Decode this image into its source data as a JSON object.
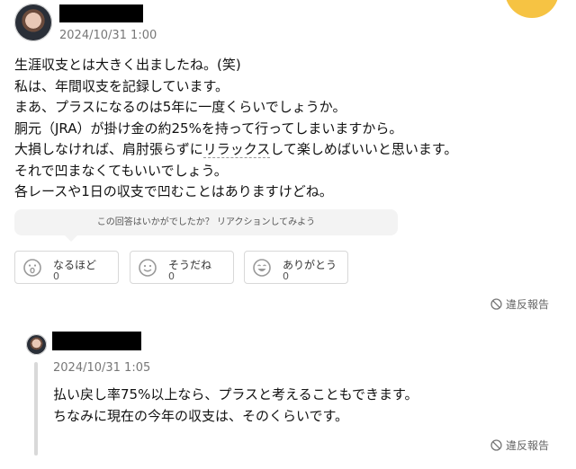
{
  "answer": {
    "timestamp": "2024/10/31 1:00",
    "lines": [
      "生涯収支とは大きく出ましたね。(笑)",
      "私は、年間収支を記録しています。",
      "まあ、プラスになるのは5年に一度くらいでしょうか。",
      "胴元（JRA）が掛け金の約25%を持って行ってしまいますから。",
      "大損しなければ、肩肘張らずに",
      "リラックス",
      "して楽しめばいいと思います。",
      "それで凹まなくてもいいでしょう。",
      "各レースや1日の収支で凹むことはありますけどね。"
    ],
    "prompt": "この回答はいかがでしたか？ リアクションしてみよう",
    "reactions": [
      {
        "label": "なるほど",
        "count": "0",
        "icon": "surprised-face-icon"
      },
      {
        "label": "そうだね",
        "count": "0",
        "icon": "smile-face-icon"
      },
      {
        "label": "ありがとう",
        "count": "0",
        "icon": "happy-face-icon"
      }
    ],
    "report_label": "違反報告"
  },
  "reply": {
    "timestamp": "2024/10/31 1:05",
    "lines": [
      "払い戻し率75%以上なら、プラスと考えることもできます。",
      "ちなみに現在の今年の収支は、そのくらいです。"
    ],
    "report_label": "違反報告"
  },
  "colors": {
    "accent": "#f6c343",
    "icon_gray": "#9a9a9a"
  }
}
